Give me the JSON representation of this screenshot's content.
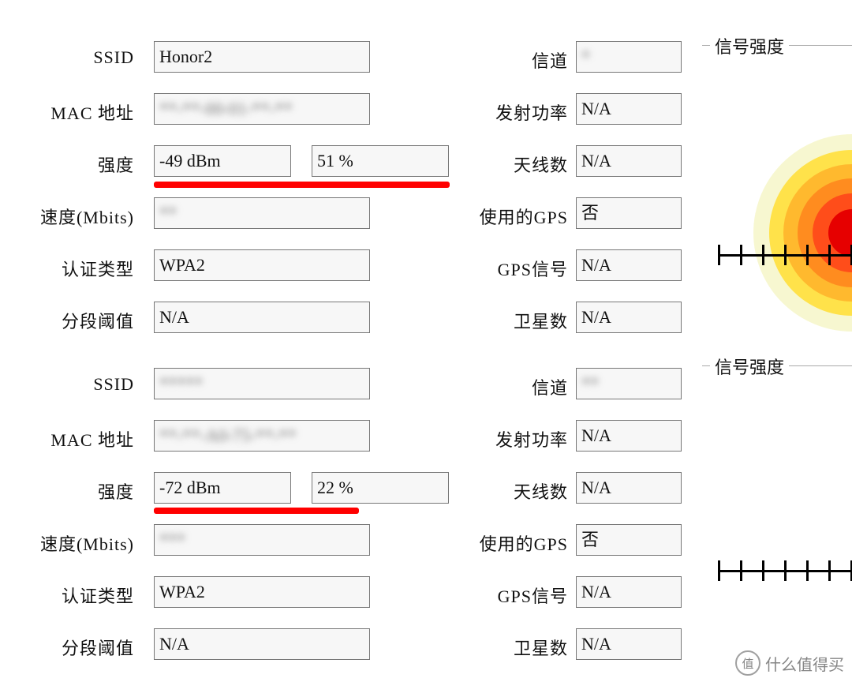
{
  "labels": {
    "ssid": "SSID",
    "mac": "MAC 地址",
    "strength": "强度",
    "speed": "速度(Mbits)",
    "auth": "认证类型",
    "frag": "分段阈值",
    "channel": "信道",
    "txpower": "发射功率",
    "antennas": "天线数",
    "gps_used": "使用的GPS",
    "gps_signal": "GPS信号",
    "satellites": "卫星数",
    "signal_strength_group": "信号强度"
  },
  "top": {
    "ssid": "Honor2",
    "mac": "**-**-00-01-**-**",
    "strength_dbm": "-49 dBm",
    "strength_pct": "51 %",
    "speed": "**",
    "auth": "WPA2",
    "frag": "N/A",
    "channel": "*",
    "txpower": "N/A",
    "antennas": "N/A",
    "gps_used": "否",
    "gps_signal": "N/A",
    "satellites": "N/A"
  },
  "bottom": {
    "ssid": "*****",
    "mac": "**-**-A0-75-**-**",
    "strength_dbm": "-72 dBm",
    "strength_pct": "22 %",
    "speed": "***",
    "auth": "WPA2",
    "frag": "N/A",
    "channel": "**",
    "txpower": "N/A",
    "antennas": "N/A",
    "gps_used": "否",
    "gps_signal": "N/A",
    "satellites": "N/A"
  },
  "bullseye_colors": [
    "#f7f7d0",
    "#ffe24a",
    "#ffb92e",
    "#ff8c1f",
    "#ff4d1a",
    "#e60000"
  ],
  "watermark": {
    "icon": "值",
    "text": "什么值得买"
  }
}
